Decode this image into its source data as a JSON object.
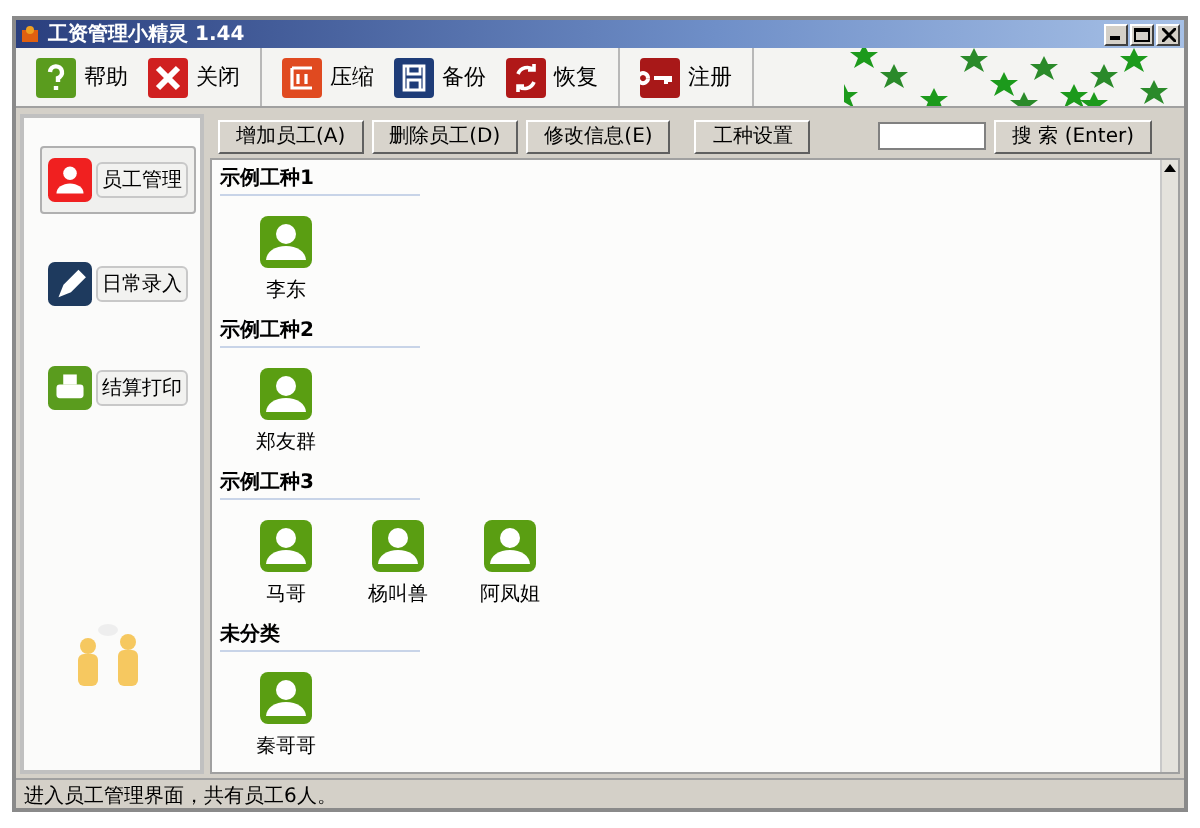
{
  "window": {
    "title": "工资管理小精灵 1.44"
  },
  "toolbar": {
    "groups": [
      [
        {
          "kind": "help",
          "label": "帮助"
        },
        {
          "kind": "close",
          "label": "关闭"
        }
      ],
      [
        {
          "kind": "compress",
          "label": "压缩"
        },
        {
          "kind": "backup",
          "label": "备份"
        },
        {
          "kind": "restore",
          "label": "恢复"
        }
      ],
      [
        {
          "kind": "register",
          "label": "注册"
        }
      ]
    ]
  },
  "sidebar": {
    "items": [
      {
        "kind": "staff",
        "label": "员工管理",
        "selected": true
      },
      {
        "kind": "entry",
        "label": "日常录入",
        "selected": false
      },
      {
        "kind": "print",
        "label": "结算打印",
        "selected": false
      }
    ]
  },
  "actions": [
    "增加员工(A)",
    "删除员工(D)",
    "修改信息(E)",
    "工种设置"
  ],
  "search": {
    "button": "搜 索 (Enter)"
  },
  "groups": [
    {
      "title": "示例工种1",
      "employees": [
        "李东"
      ]
    },
    {
      "title": "示例工种2",
      "employees": [
        "郑友群"
      ]
    },
    {
      "title": "示例工种3",
      "employees": [
        "马哥",
        "杨叫兽",
        "阿凤姐"
      ]
    },
    {
      "title": "未分类",
      "employees": [
        "秦哥哥"
      ]
    }
  ],
  "status_bar": "进入员工管理界面，共有员工6人。"
}
